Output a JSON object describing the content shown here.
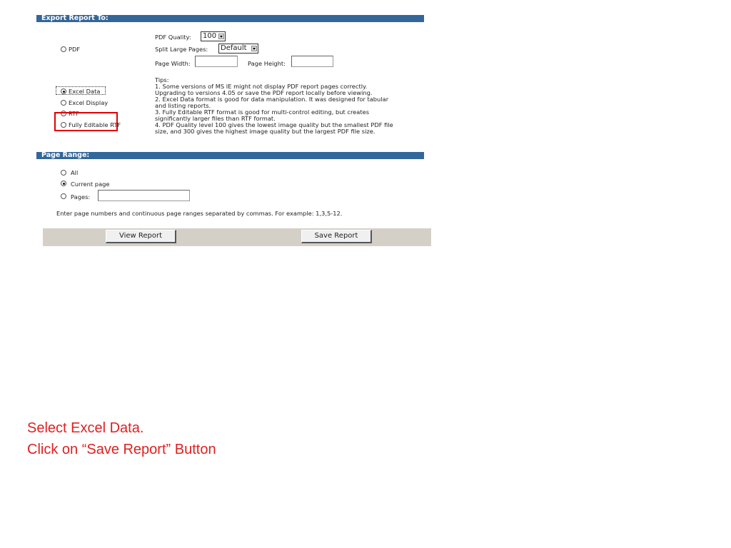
{
  "export_section": {
    "title": "Export Report To:"
  },
  "formats": {
    "pdf": "PDF",
    "excel_data": "Excel Data",
    "excel_display": "Excel Display",
    "rtf": "RTF",
    "fully_editable_rtf": "Fully Editable RTF",
    "selected": "excel_data"
  },
  "pdf_options": {
    "quality_label": "PDF Quality:",
    "quality_value": "100",
    "split_label": "Split Large Pages:",
    "split_value": "Default",
    "width_label": "Page Width:",
    "height_label": "Page Height:"
  },
  "tips": [
    "Tips:",
    "1. Some versions of MS IE might not display PDF report pages correctly.",
    "Upgrading to versions 4.05 or save the PDF report locally before viewing.",
    "2. Excel Data format is good for data manipulation. It was designed for tabular",
    "and listing reports.",
    "3. Fully Editable RTF format is good for multi-control editing, but creates",
    "significantly larger files than RTF format.",
    "4. PDF Quality level 100 gives the lowest image quality but the smallest PDF file",
    "size, and 300 gives the highest image quality but the largest PDF file size."
  ],
  "page_range": {
    "title": "Page Range:",
    "all": "All",
    "current": "Current page",
    "pages": "Pages:",
    "selected": "current",
    "hint": "Enter page numbers and continuous page ranges separated by commas. For example: 1,3,5-12."
  },
  "buttons": {
    "view": "View Report",
    "save": "Save Report"
  },
  "instructions": [
    "Select Excel Data.",
    "Click on “Save Report” Button"
  ],
  "colors": {
    "section_bar": "#336699",
    "highlight": "#e00000",
    "instruction_text": "#e02020"
  }
}
